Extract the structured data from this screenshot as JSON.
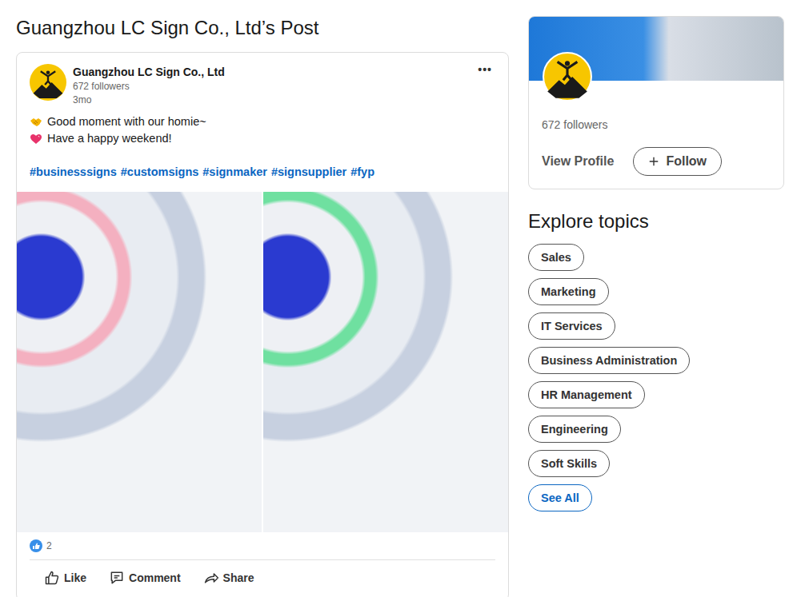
{
  "page": {
    "title": "Guangzhou LC Sign Co., Ltd’s Post"
  },
  "post": {
    "author": "Guangzhou LC Sign Co., Ltd",
    "followers": "672 followers",
    "time": "3mo",
    "more": "•••",
    "lines": [
      {
        "icon": "handshake",
        "text": "Good moment with our homie~"
      },
      {
        "icon": "heart",
        "text": "Have a happy weekend!"
      }
    ],
    "hashtags": [
      "#businesssigns",
      "#customsigns",
      "#signmaker",
      "#signsupplier",
      "#fyp"
    ],
    "reactions": "2",
    "actions": [
      {
        "kind": "like",
        "label": "Like"
      },
      {
        "kind": "comment",
        "label": "Comment"
      },
      {
        "kind": "share",
        "label": "Share"
      }
    ]
  },
  "sidebar": {
    "followers": "672 followers",
    "view_profile": "View Profile",
    "follow": "Follow"
  },
  "topics": {
    "title": "Explore topics",
    "items": [
      "Sales",
      "Marketing",
      "IT Services",
      "Business Administration",
      "HR Management",
      "Engineering",
      "Soft Skills"
    ],
    "see_all": "See All"
  }
}
